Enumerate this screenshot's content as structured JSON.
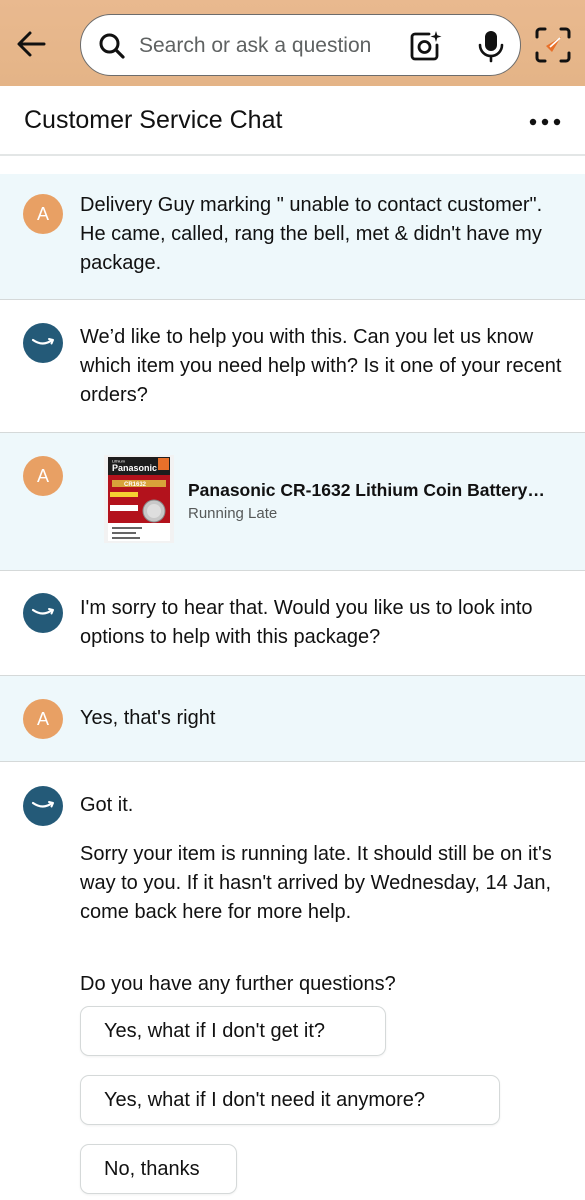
{
  "search": {
    "placeholder": "Search or ask a question"
  },
  "header": {
    "title": "Customer Service Chat"
  },
  "messages": [
    {
      "sender": "user",
      "avatar_letter": "A",
      "text": "Delivery Guy marking \" unable to contact customer\". He came, called, rang the bell, met & didn't have my package."
    },
    {
      "sender": "bot",
      "text": "We’d like to help you with this. Can you let us know which item you need help with? Is it one of your recent orders?"
    },
    {
      "sender": "user",
      "avatar_letter": "A",
      "product": {
        "title": "Panasonic CR-1632 Lithium Coin Battery…",
        "status": "Running Late",
        "image_brand": "Panasonic",
        "image_model": "CR1632"
      }
    },
    {
      "sender": "bot",
      "text": "I'm sorry to hear that. Would you like us to look into options to help with this package?"
    },
    {
      "sender": "user",
      "avatar_letter": "A",
      "text": "Yes, that's right"
    },
    {
      "sender": "bot",
      "text": "Got it.",
      "text2": "Sorry your item is running late. It should still be on it's way to you. If it hasn't arrived by Wednesday, 14 Jan, come back here for more help.",
      "text3": "Do you have any further questions?"
    }
  ],
  "quick_replies": [
    "Yes, what if I don't get it?",
    "Yes, what if I don't need it anymore?",
    "No, thanks"
  ],
  "colors": {
    "topbar": "#e4b487",
    "user_bubble": "#eef8fb",
    "user_avatar": "#e8a064",
    "bot_avatar": "#245a78"
  }
}
